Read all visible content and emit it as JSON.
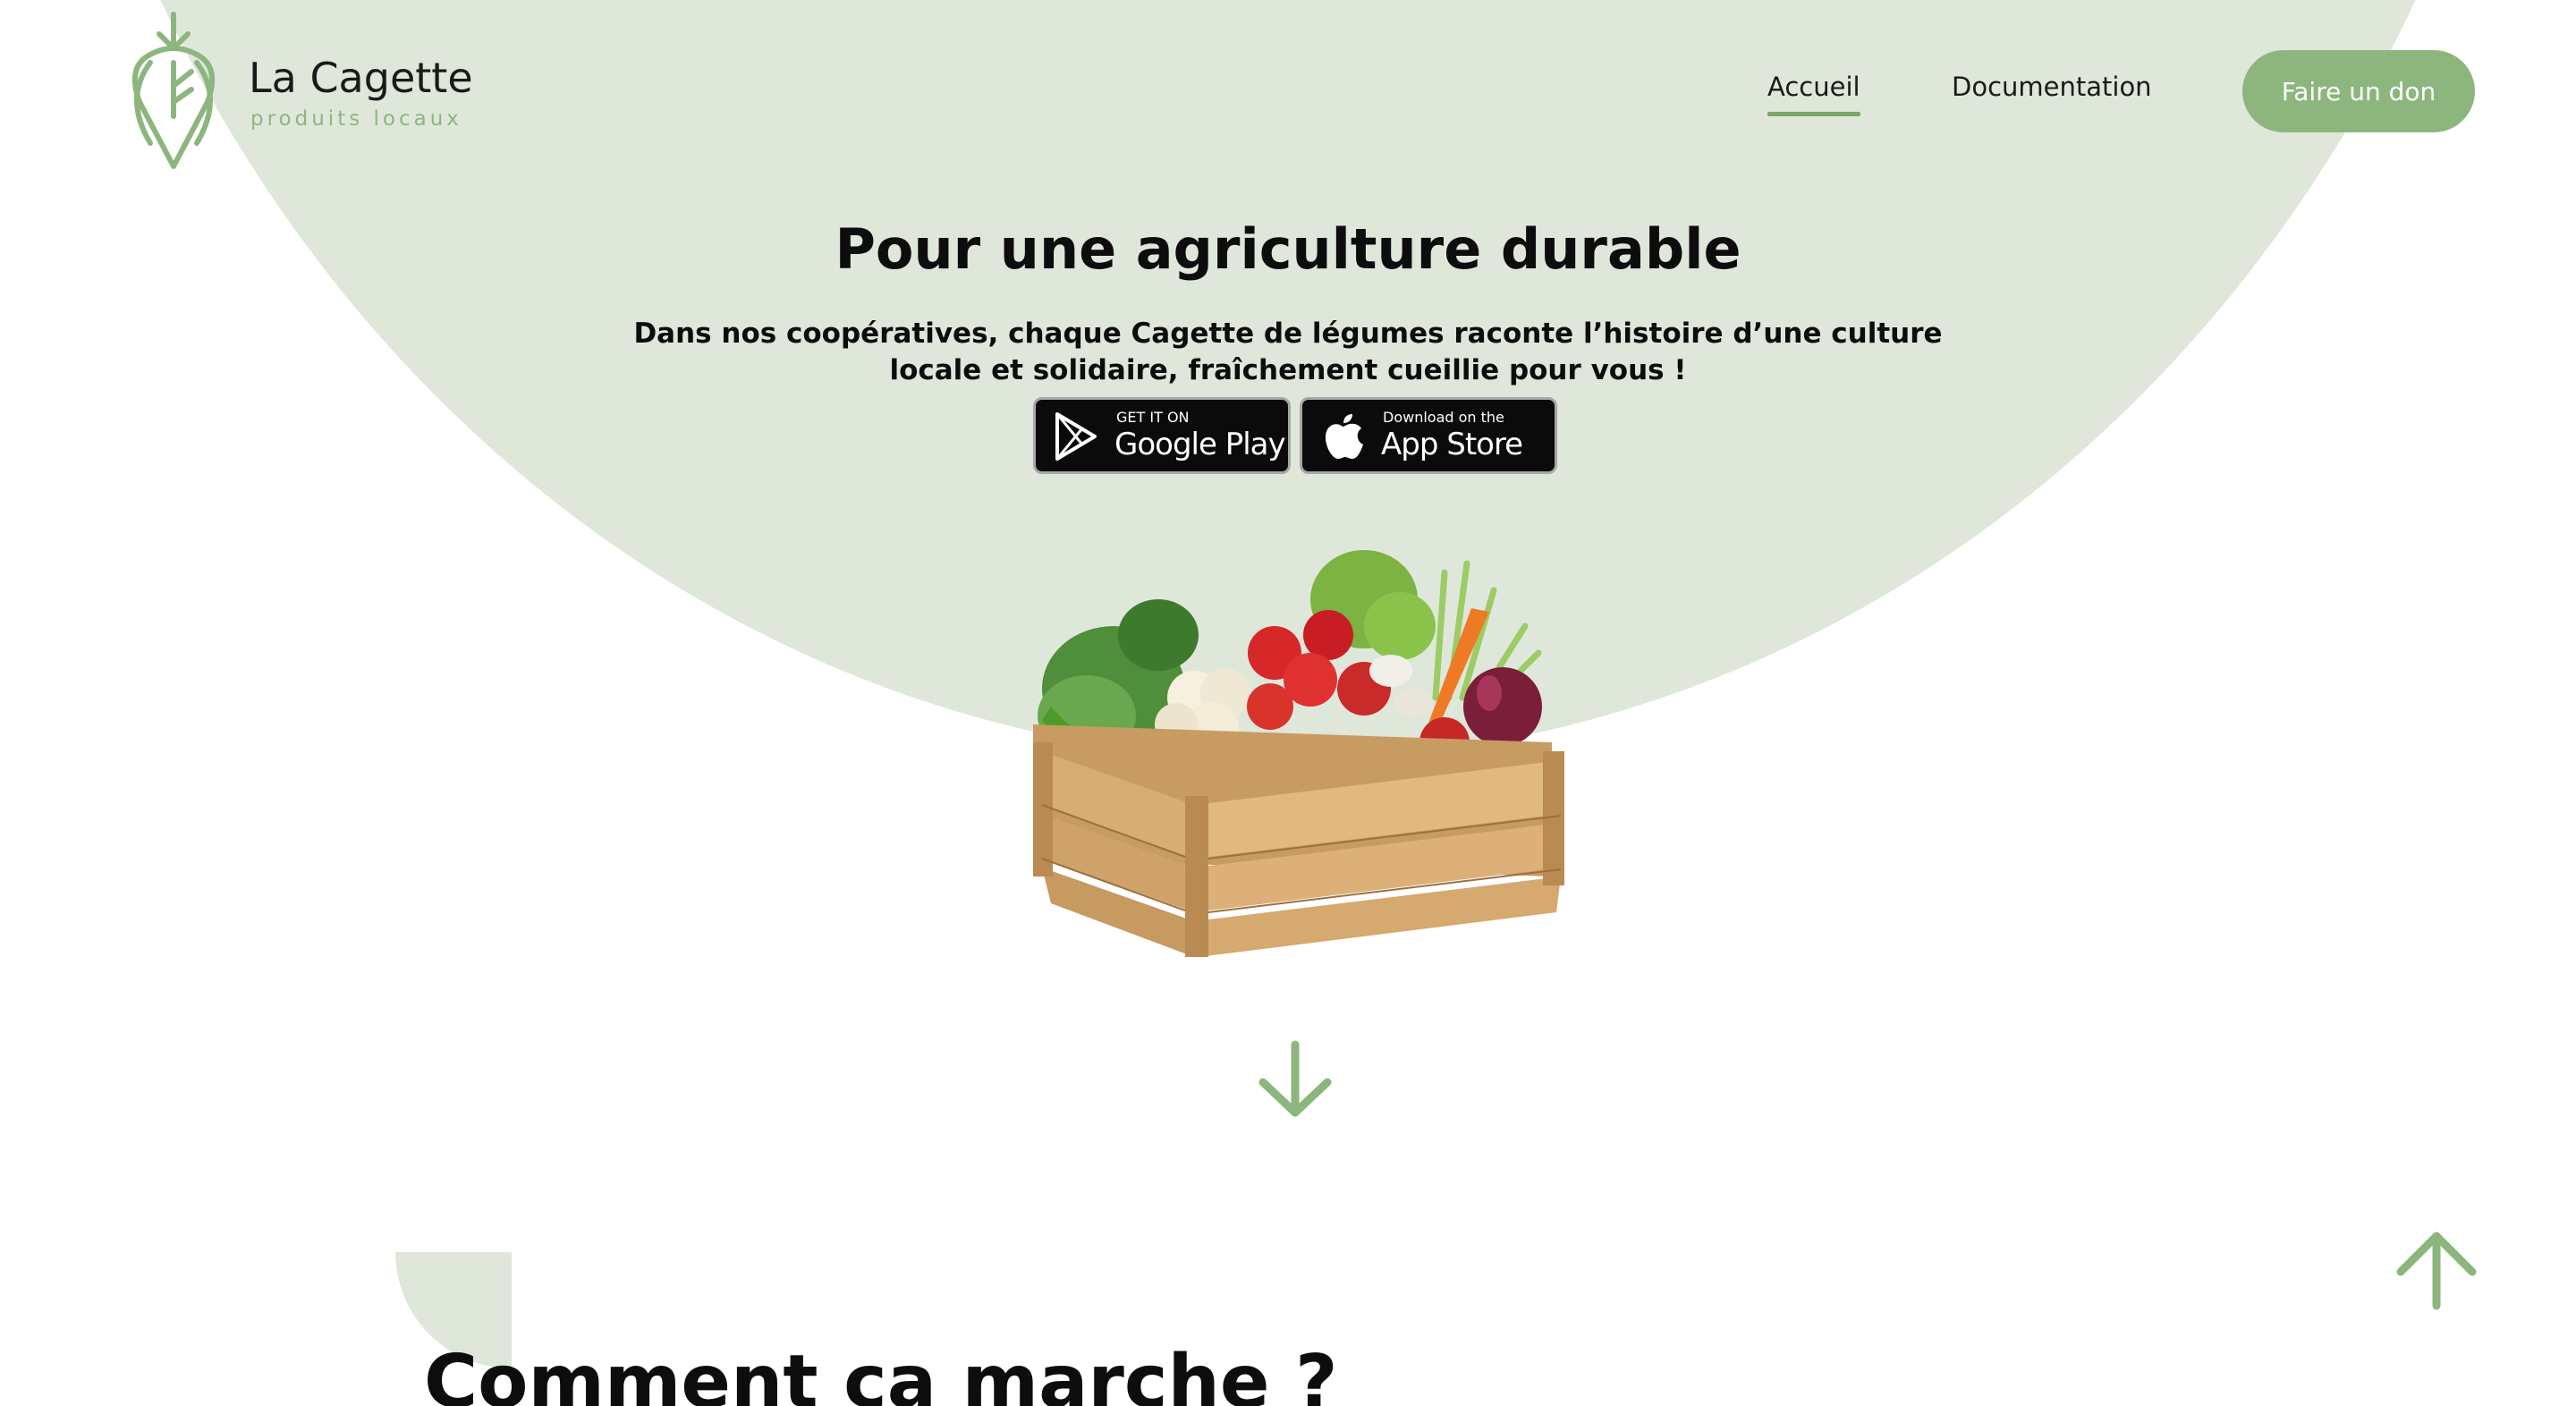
{
  "brand": {
    "name": "La Cagette",
    "tagline": "produits locaux",
    "accent_color": "#8db67e",
    "hero_bg_color": "#dfe7da"
  },
  "nav": {
    "items": [
      {
        "label": "Accueil",
        "active": true
      },
      {
        "label": "Documentation",
        "active": false
      }
    ],
    "cta_label": "Faire un don"
  },
  "hero": {
    "title": "Pour une agriculture durable",
    "description": "Dans nos coopératives, chaque Cagette de légumes raconte l’histoire d’une culture locale et solidaire, fraîchement cueillie pour vous !",
    "stores": {
      "google": {
        "small": "GET IT ON",
        "big": "Google Play",
        "icon": "google-play-icon"
      },
      "apple": {
        "small": "Download on the",
        "big": "App Store",
        "icon": "apple-icon"
      }
    },
    "image": "vegetable-crate"
  },
  "icons": {
    "scroll_down": "arrow-down-icon",
    "back_to_top": "arrow-up-icon"
  },
  "section": {
    "title": "Comment ça marche ?"
  }
}
